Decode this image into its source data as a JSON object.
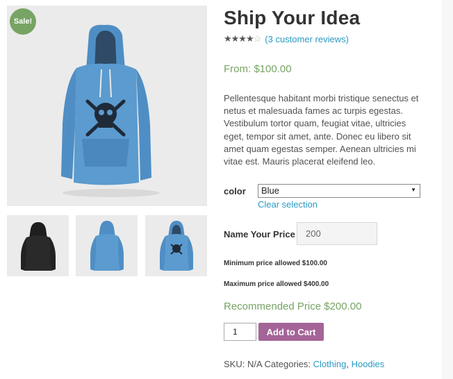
{
  "gallery": {
    "sale_badge": "Sale!",
    "main_image": "blue-hoodie-with-skull-print",
    "thumbnails": [
      "black-hoodie-back",
      "blue-hoodie-back",
      "blue-hoodie-front"
    ]
  },
  "product": {
    "title": "Ship Your Idea",
    "rating": {
      "value": 4,
      "max": 5,
      "review_link": "(3 customer reviews)"
    },
    "price": "From: $100.00",
    "description": "Pellentesque habitant morbi tristique senectus et netus et malesuada fames ac turpis egestas. Vestibulum tortor quam, feugiat vitae, ultricies eget, tempor sit amet, ante. Donec eu libero sit amet quam egestas semper. Aenean ultricies mi vitae est. Mauris placerat eleifend leo."
  },
  "variation": {
    "label": "color",
    "selected": "Blue",
    "clear_link": "Clear selection"
  },
  "name_your_price": {
    "label": "Name Your Price",
    "value": "200",
    "min_text": "Minimum price allowed $100.00",
    "max_text": "Maximum price allowed $400.00",
    "recommended": "Recommended Price $200.00"
  },
  "cart": {
    "quantity": "1",
    "button_label": "Add to Cart"
  },
  "meta": {
    "sku_text": "SKU: N/A Categories:",
    "categories": [
      "Clothing",
      "Hoodies"
    ],
    "separator": ","
  },
  "colors": {
    "sale_green": "#77a464",
    "link_blue": "#2a9bc4",
    "button_purple": "#a46497",
    "hoodie_blue": "#5b9bcf",
    "hoodie_black": "#2a2a2a"
  }
}
